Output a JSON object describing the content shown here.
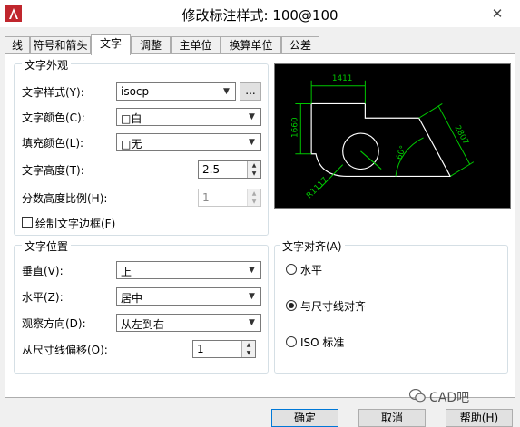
{
  "window": {
    "title": "修改标注样式: 100@100",
    "close_glyph": "✕",
    "app_icon": "autocad-icon"
  },
  "tabs": [
    {
      "label": "线"
    },
    {
      "label": "符号和箭头"
    },
    {
      "label": "文字"
    },
    {
      "label": "调整"
    },
    {
      "label": "主单位"
    },
    {
      "label": "换算单位"
    },
    {
      "label": "公差"
    }
  ],
  "active_tab": "文字",
  "appearance": {
    "title": "文字外观",
    "style_label": "文字样式(Y):",
    "style_value": "isocp",
    "browse_label": "...",
    "color_label": "文字颜色(C):",
    "color_value": "□白",
    "fill_label": "填充颜色(L):",
    "fill_value": "□无",
    "height_label": "文字高度(T):",
    "height_value": "2.5",
    "fraction_label": "分数高度比例(H):",
    "fraction_value": "1",
    "frame_label": "绘制文字边框(F)",
    "frame_checked": false
  },
  "preview": {
    "dim_top": "1411",
    "dim_left": "1660",
    "dim_right": "2807",
    "dim_angle": "60°",
    "dim_radius": "R1117",
    "colors": {
      "background": "#000000",
      "lines": "#ffffff",
      "dimensions": "#00c800"
    }
  },
  "placement": {
    "title": "文字位置",
    "vertical_label": "垂直(V):",
    "vertical_value": "上",
    "horizontal_label": "水平(Z):",
    "horizontal_value": "居中",
    "direction_label": "观察方向(D):",
    "direction_value": "从左到右",
    "offset_label": "从尺寸线偏移(O):",
    "offset_value": "1"
  },
  "alignment": {
    "title": "文字对齐(A)",
    "options": [
      {
        "label": "水平",
        "selected": false
      },
      {
        "label": "与尺寸线对齐",
        "selected": true
      },
      {
        "label": "ISO 标准",
        "selected": false
      }
    ]
  },
  "buttons": {
    "ok": "确定",
    "cancel": "取消",
    "help": "帮助(H)"
  },
  "watermark": {
    "text": "CAD吧",
    "icon": "wechat-icon"
  }
}
